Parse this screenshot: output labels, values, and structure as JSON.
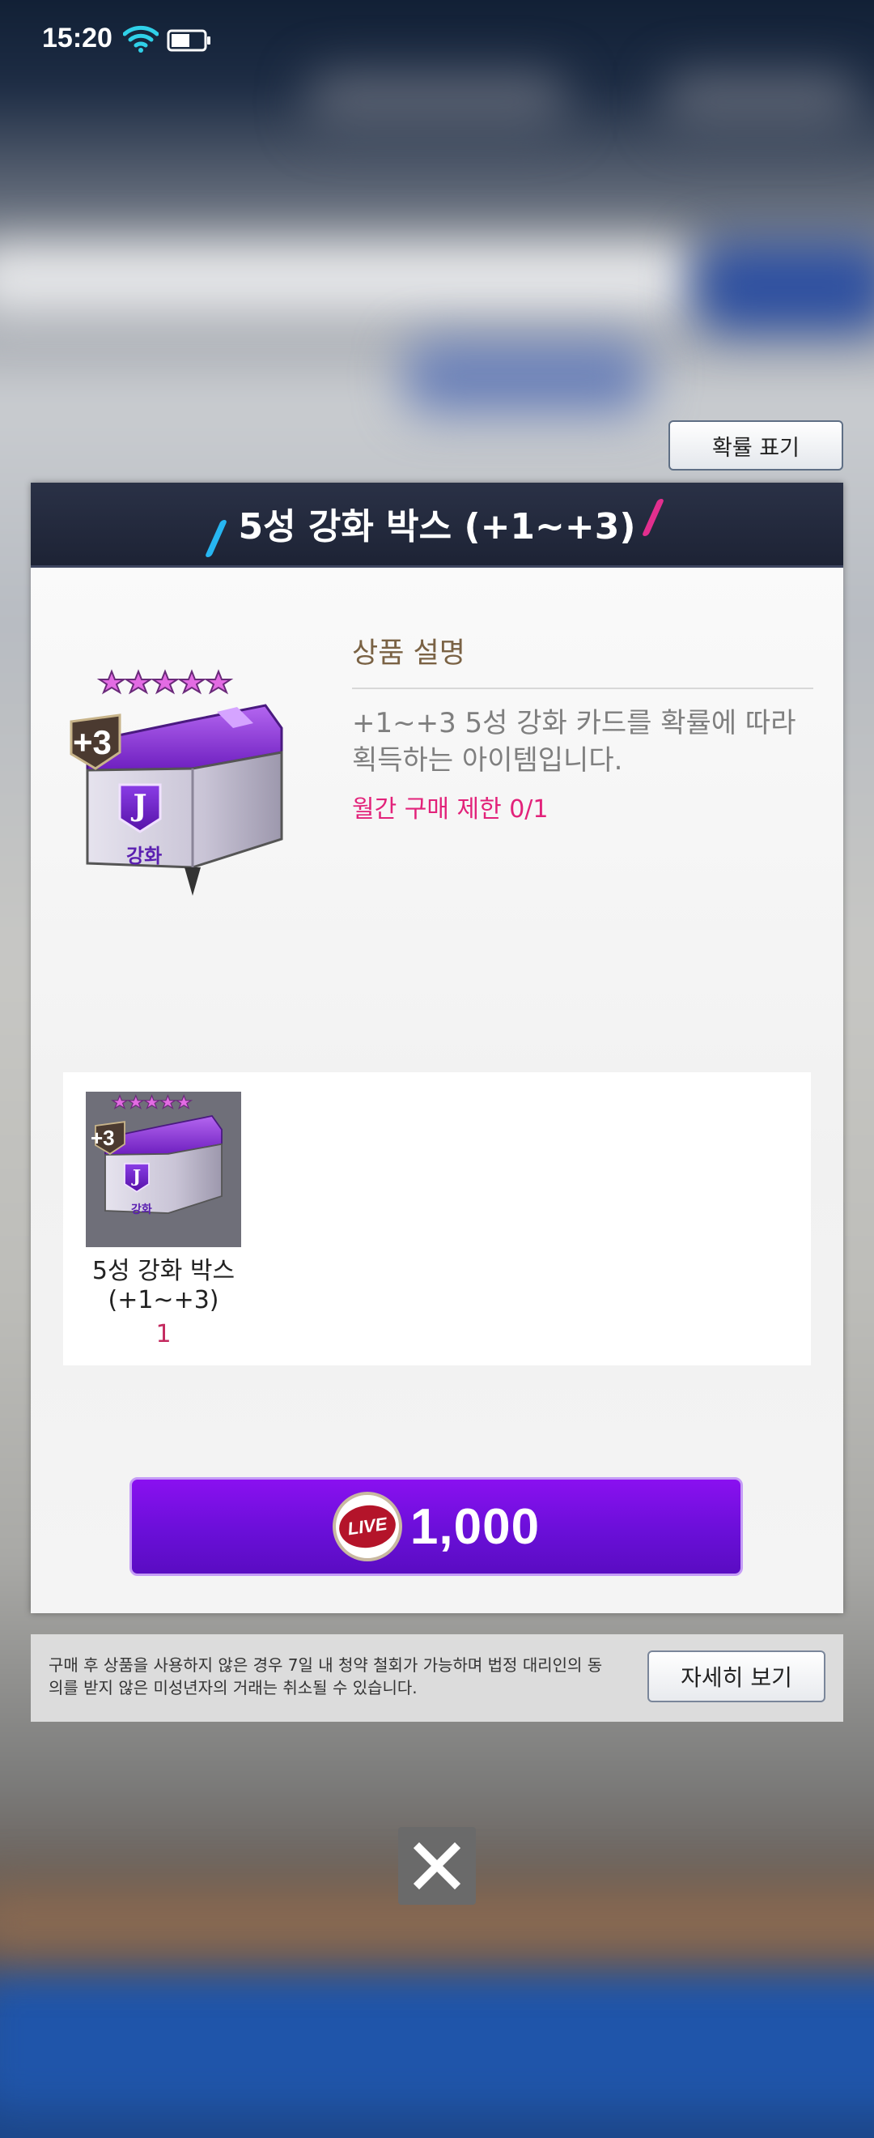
{
  "status_bar": {
    "time": "15:20"
  },
  "probability_button": {
    "label": "확률 표기"
  },
  "modal": {
    "title": "5성 강화 박스 (+1~+3)",
    "description": {
      "heading": "상품 설명",
      "text": "+1~+3 5성 강화 카드를 확률에 따라 획득하는 아이템입니다.",
      "purchase_limit": "월간 구매 제한 0/1"
    },
    "box_art": {
      "badge": "+3",
      "label": "강화",
      "stars": 5
    },
    "items": [
      {
        "name": "5성 강화 박스 (+1~+3)",
        "count": "1",
        "badge": "+3",
        "label": "강화",
        "stars": 5
      }
    ],
    "buy_button": {
      "currency_icon": "live-coin-icon",
      "currency_text": "LIVE",
      "price": "1,000"
    }
  },
  "notice": {
    "text": "구매 후 상품을 사용하지 않은 경우 7일 내 청약 철회가 가능하며 법정 대리인의 동의를 받지 않은 미성년자의 거래는 취소될 수 있습니다.",
    "detail_button": "자세히 보기"
  },
  "close_button": {
    "icon": "close-icon"
  },
  "colors": {
    "accent_purple": "#7a10e6",
    "header_navy": "#232a3e",
    "limit_pink": "#e2227a"
  }
}
